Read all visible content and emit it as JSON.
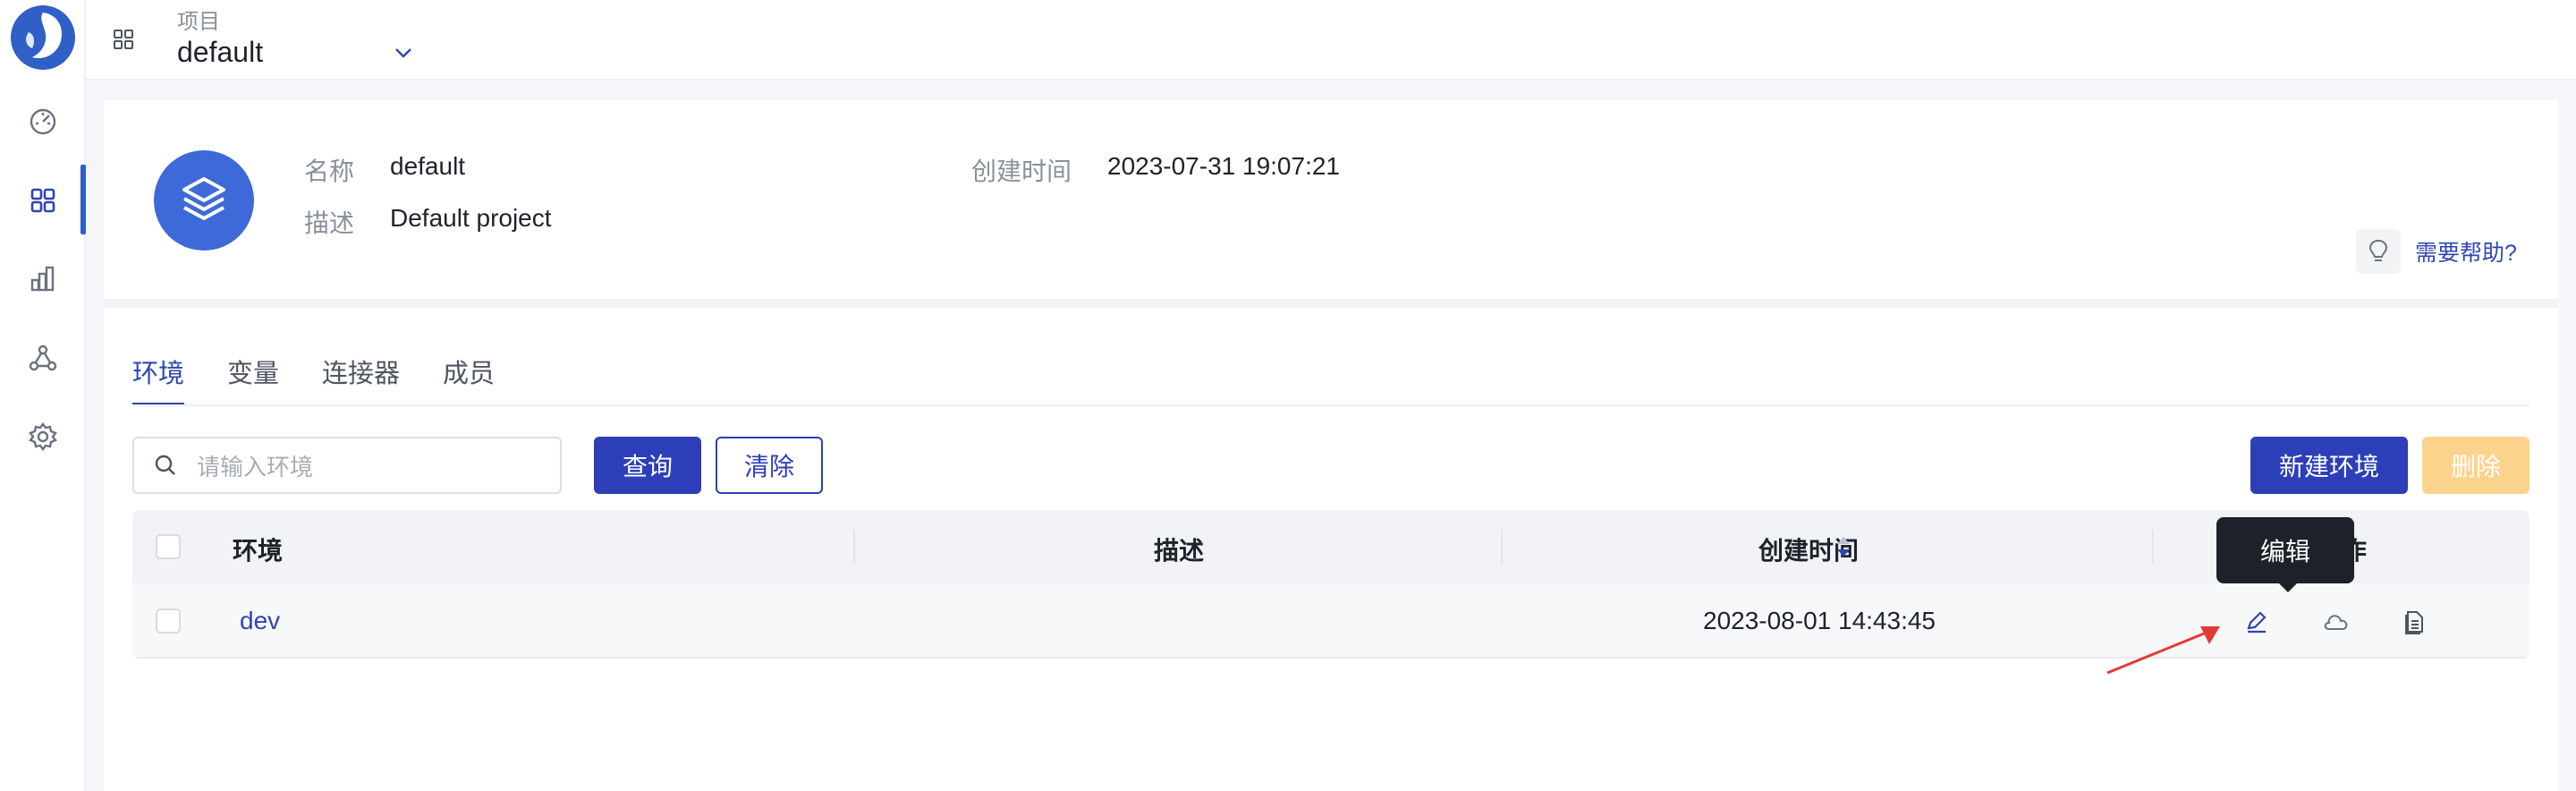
{
  "topbar": {
    "project_label": "项目",
    "project_value": "default"
  },
  "project": {
    "name_label": "名称",
    "name_value": "default",
    "desc_label": "描述",
    "desc_value": "Default project",
    "created_label": "创建时间",
    "created_value": "2023-07-31 19:07:21",
    "help_text": "需要帮助?"
  },
  "tabs": [
    {
      "label": "环境",
      "active": true
    },
    {
      "label": "变量",
      "active": false
    },
    {
      "label": "连接器",
      "active": false
    },
    {
      "label": "成员",
      "active": false
    }
  ],
  "toolbar": {
    "search_placeholder": "请输入环境",
    "query_label": "查询",
    "clear_label": "清除",
    "new_env_label": "新建环境",
    "delete_label": "删除"
  },
  "table": {
    "headers": {
      "env": "环境",
      "desc": "描述",
      "created": "创建时间",
      "actions": "操作"
    },
    "rows": [
      {
        "env": "dev",
        "desc": "",
        "created": "2023-08-01 14:43:45"
      }
    ]
  },
  "tooltip": {
    "text": "编辑"
  },
  "colors": {
    "primary": "#2c3fb8",
    "accent_link": "#2f46b0",
    "disabled": "#fbd38d",
    "annotation_arrow": "#e53935"
  },
  "icons": {
    "sidebar": [
      "dashboard-icon",
      "grid-icon",
      "chart-icon",
      "nodes-icon",
      "settings-icon"
    ],
    "row_actions": [
      "edit-icon",
      "cloud-icon",
      "document-icon"
    ]
  }
}
